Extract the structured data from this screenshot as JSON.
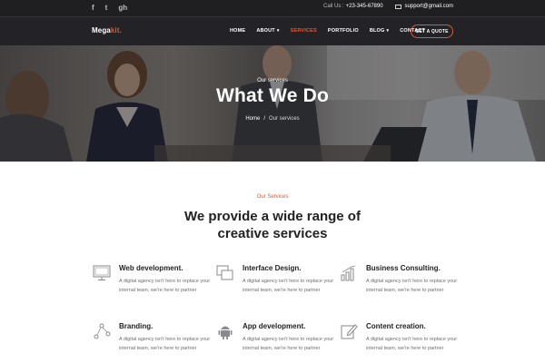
{
  "topbar": {
    "social": [
      "f",
      "t",
      "gh"
    ],
    "call_label": "Call Us :",
    "call_number": "+23-345-67890",
    "email": "support@gmail.com"
  },
  "nav": {
    "logo_main": "Mega",
    "logo_accent": "kit.",
    "items": [
      {
        "label": "HOME",
        "caret": false
      },
      {
        "label": "ABOUT",
        "caret": true
      },
      {
        "label": "SERVICES",
        "caret": false,
        "active": true
      },
      {
        "label": "PORTFOLIO",
        "caret": false
      },
      {
        "label": "BLOG",
        "caret": true
      },
      {
        "label": "CONTACT",
        "caret": false
      }
    ],
    "cta": "GET A QUOTE"
  },
  "hero": {
    "subtitle": "Our services",
    "title": "What We Do",
    "breadcrumb": {
      "home": "Home",
      "separator": "/",
      "current": "Our services"
    }
  },
  "services": {
    "kicker": "Our Services",
    "title_line1": "We provide a wide range of",
    "title_line2": "creative services",
    "cards": [
      {
        "icon": "desktop-icon",
        "title": "Web development.",
        "description": "A digital agency isn't here to replace your internal team, we're here to partner"
      },
      {
        "icon": "layers-icon",
        "title": "Interface Design.",
        "description": "A digital agency isn't here to replace your internal team, we're here to partner"
      },
      {
        "icon": "bar-chart-icon",
        "title": "Business Consulting.",
        "description": "A digital agency isn't here to replace your internal team, we're here to partner"
      },
      {
        "icon": "branding-icon",
        "title": "Branding.",
        "description": "A digital agency isn't here to replace your internal team, we're here to partner"
      },
      {
        "icon": "android-icon",
        "title": "App development.",
        "description": "A digital agency isn't here to replace your internal team, we're here to partner"
      },
      {
        "icon": "pencil-icon",
        "title": "Content creation.",
        "description": "A digital agency isn't here to replace your internal team, we're here to partner"
      }
    ]
  },
  "colors": {
    "accent": "#e4572e",
    "dark": "#232327",
    "text": "#222222",
    "muted": "#6e6e72"
  }
}
